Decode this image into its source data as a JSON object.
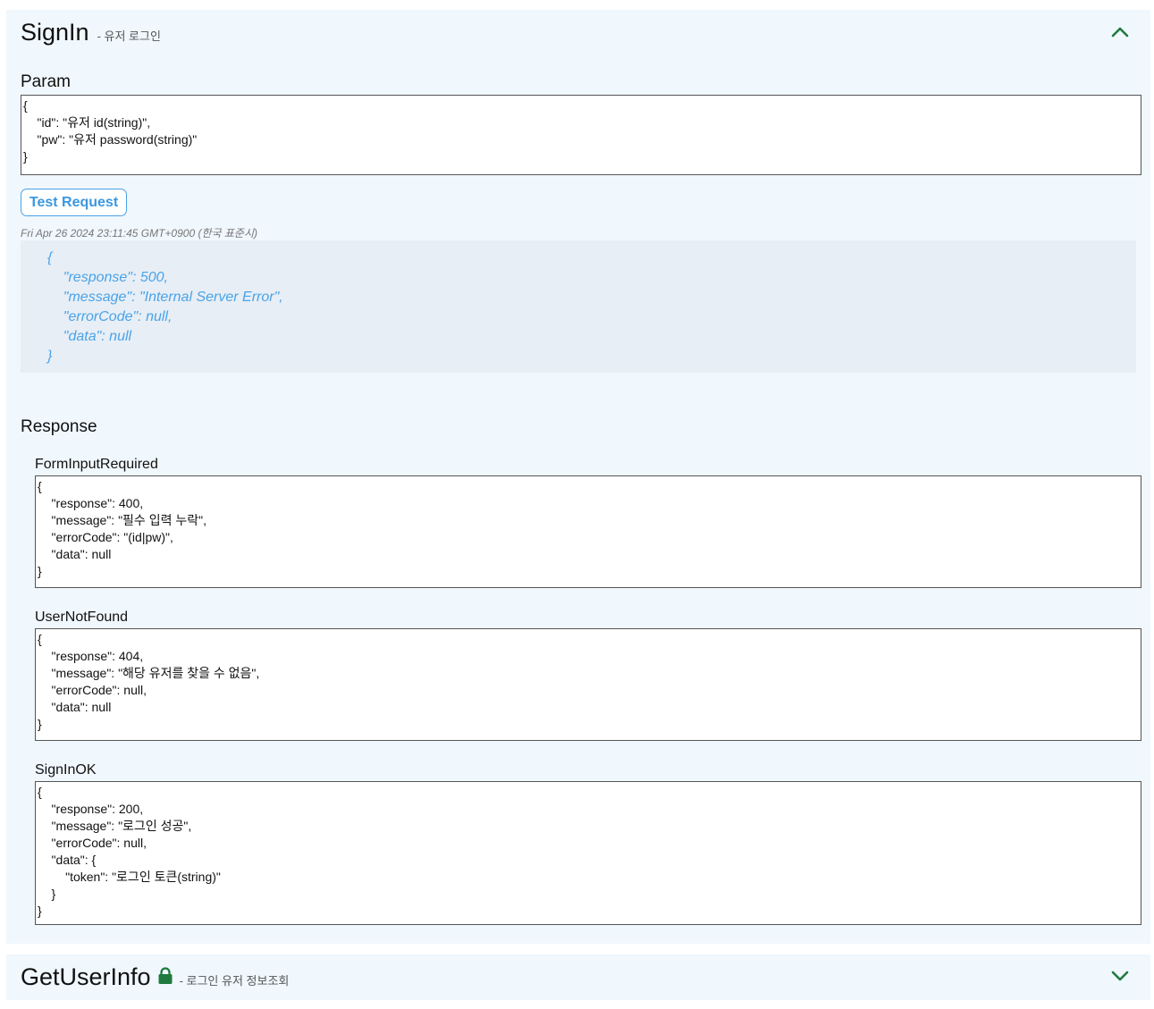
{
  "signin": {
    "title": "SignIn",
    "subtitle": "- 유저 로그인",
    "collapse_icon": "chevron-up-icon",
    "param_label": "Param",
    "param_value": "{\n    \"id\": \"유저 id(string)\",\n    \"pw\": \"유저 password(string)\"\n}",
    "test_button_label": "Test Request",
    "timestamp": "Fri Apr 26 2024 23:11:45 GMT+0900 (한국 표준시)",
    "result": "{\n    \"response\": 500,\n    \"message\": \"Internal Server Error\",\n    \"errorCode\": null,\n    \"data\": null\n}",
    "response_label": "Response",
    "responses": [
      {
        "name": "FormInputRequired",
        "body": "{\n    \"response\": 400,\n    \"message\": \"필수 입력 누락\",\n    \"errorCode\": \"(id|pw)\",\n    \"data\": null\n}"
      },
      {
        "name": "UserNotFound",
        "body": "{\n    \"response\": 404,\n    \"message\": \"해당 유저를 찾을 수 없음\",\n    \"errorCode\": null,\n    \"data\": null\n}"
      },
      {
        "name": "SignInOK",
        "body": "{\n    \"response\": 200,\n    \"message\": \"로그인 성공\",\n    \"errorCode\": null,\n    \"data\": {\n        \"token\": \"로그인 토큰(string)\"\n    }\n}"
      }
    ]
  },
  "getuserinfo": {
    "title": "GetUserInfo",
    "lock_icon": "lock-icon",
    "subtitle": "- 로그인 유저 정보조회",
    "expand_icon": "chevron-down-icon"
  },
  "colors": {
    "card_bg": "#f0f7fd",
    "accent": "#4aa3e8",
    "chevron": "#1e7a3e",
    "lock": "#1e7a3e"
  }
}
